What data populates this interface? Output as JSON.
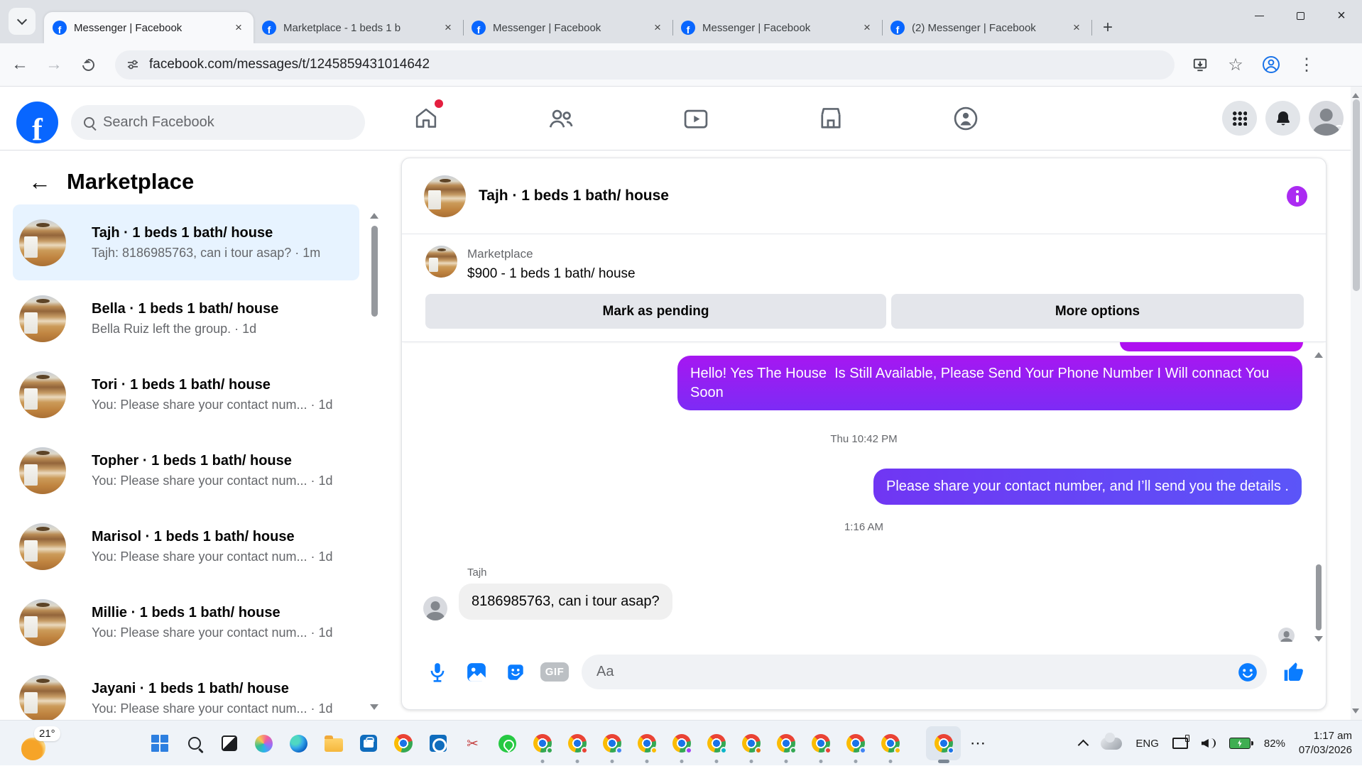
{
  "browser": {
    "tabs": [
      {
        "title": "Messenger | Facebook"
      },
      {
        "title": "Marketplace - 1 beds 1 b"
      },
      {
        "title": "Messenger | Facebook"
      },
      {
        "title": "Messenger | Facebook"
      },
      {
        "title": "(2) Messenger | Facebook"
      }
    ],
    "url": "facebook.com/messages/t/1245859431014642"
  },
  "facebook": {
    "search_placeholder": "Search Facebook"
  },
  "sidebar": {
    "title": "Marketplace",
    "items": [
      {
        "title": "Tajh · 1 beds 1 bath/ house",
        "preview": "Tajh: 8186985763, can i tour asap? · 1m"
      },
      {
        "title": "Bella · 1 beds 1 bath/ house",
        "preview": "Bella Ruiz left the group. · 1d"
      },
      {
        "title": "Tori · 1 beds 1 bath/ house",
        "preview": "You: Please share your contact num... · 1d"
      },
      {
        "title": "Topher · 1 beds 1 bath/ house",
        "preview": "You: Please share your contact num... · 1d"
      },
      {
        "title": "Marisol · 1 beds 1 bath/ house",
        "preview": "You: Please share your contact num... · 1d"
      },
      {
        "title": "Millie · 1 beds 1 bath/ house",
        "preview": "You: Please share your contact num... · 1d"
      },
      {
        "title": "Jayani · 1 beds 1 bath/ house",
        "preview": "You: Please share your contact num... · 1d"
      }
    ]
  },
  "chat": {
    "title": "Tajh · 1 beds 1 bath/ house",
    "listing_label": "Marketplace",
    "listing_price": "$900 - 1 beds 1 bath/ house",
    "mark_pending_label": "Mark as pending",
    "more_options_label": "More options",
    "msg_out_1": "Hello! Yes The House  Is Still Available, Please Send Your Phone Number I Will connact You Soon",
    "time_1": "Thu 10:42 PM",
    "msg_out_2": "Please share your contact number, and I’ll send you the details .",
    "time_2": "1:16 AM",
    "sender_name": "Tajh",
    "msg_in_1": "8186985763, can i tour asap?",
    "gif_label": "GIF"
  },
  "composer": {
    "placeholder": "Aa"
  },
  "taskbar": {
    "weather": "21°",
    "language": "ENG",
    "battery": "82%",
    "time": "1:17 am",
    "date": "07/03/2026"
  }
}
